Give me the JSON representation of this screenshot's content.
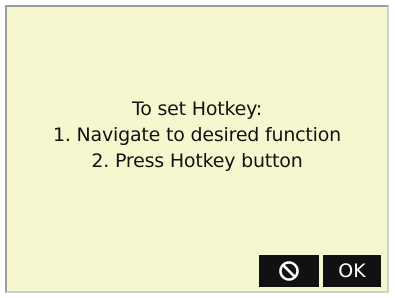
{
  "dialog": {
    "lines": [
      "To set Hotkey:",
      "1. Navigate to desired function",
      "2. Press Hotkey button"
    ]
  },
  "softkeys": {
    "cancel_icon": "prohibited-icon",
    "ok_label": "OK"
  },
  "colors": {
    "screen_background": "#f7f7cf",
    "text": "#111111",
    "softkey_background": "#111111",
    "softkey_text": "#ffffff"
  }
}
